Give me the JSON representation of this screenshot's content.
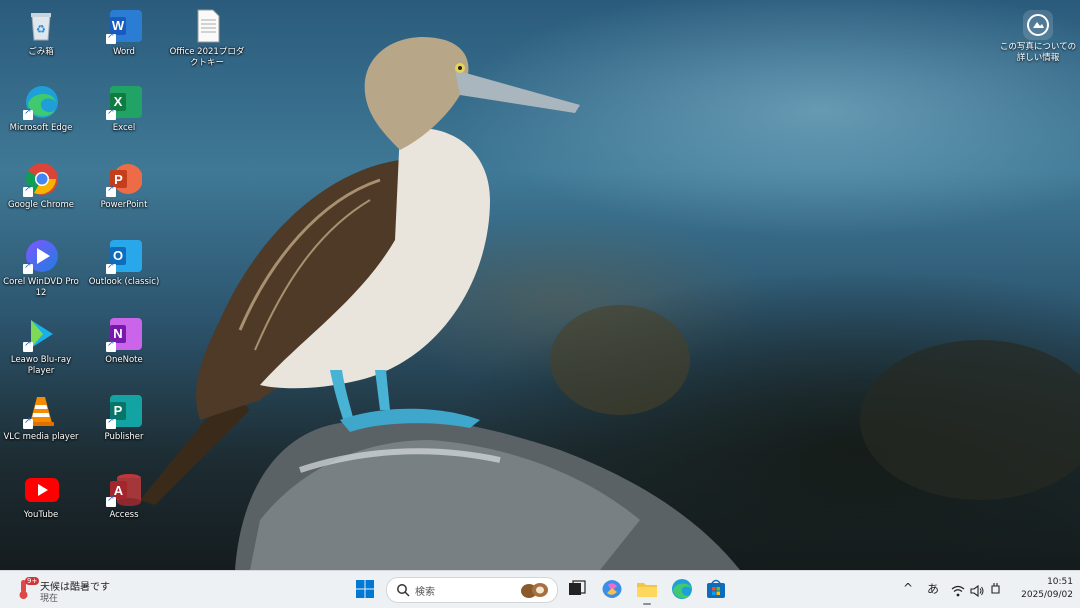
{
  "desktop": {
    "icons": [
      {
        "label": "ごみ箱",
        "icon": "recycle-bin-icon"
      },
      {
        "label": "Word",
        "icon": "word-icon"
      },
      {
        "label": "Office 2021プロダクトキー",
        "icon": "document-icon"
      },
      {
        "label": "Microsoft Edge",
        "icon": "edge-icon"
      },
      {
        "label": "Excel",
        "icon": "excel-icon"
      },
      {
        "label": "Google Chrome",
        "icon": "chrome-icon"
      },
      {
        "label": "PowerPoint",
        "icon": "powerpoint-icon"
      },
      {
        "label": "Corel WinDVD Pro 12",
        "icon": "windvd-icon"
      },
      {
        "label": "Outlook (classic)",
        "icon": "outlook-icon"
      },
      {
        "label": "Leawo Blu-ray Player",
        "icon": "leawo-icon"
      },
      {
        "label": "OneNote",
        "icon": "onenote-icon"
      },
      {
        "label": "VLC media player",
        "icon": "vlc-icon"
      },
      {
        "label": "Publisher",
        "icon": "publisher-icon"
      },
      {
        "label": "YouTube",
        "icon": "youtube-icon"
      },
      {
        "label": "Access",
        "icon": "access-icon"
      }
    ],
    "about_photo": "この写真についての詳しい情報"
  },
  "taskbar": {
    "weather_title": "天候は酷暑です",
    "weather_sub": "現在",
    "weather_badge": "9+",
    "search_placeholder": "検索",
    "ime": "あ",
    "time": "10:51",
    "date": "2025/09/02",
    "accent": "#0078d4"
  }
}
